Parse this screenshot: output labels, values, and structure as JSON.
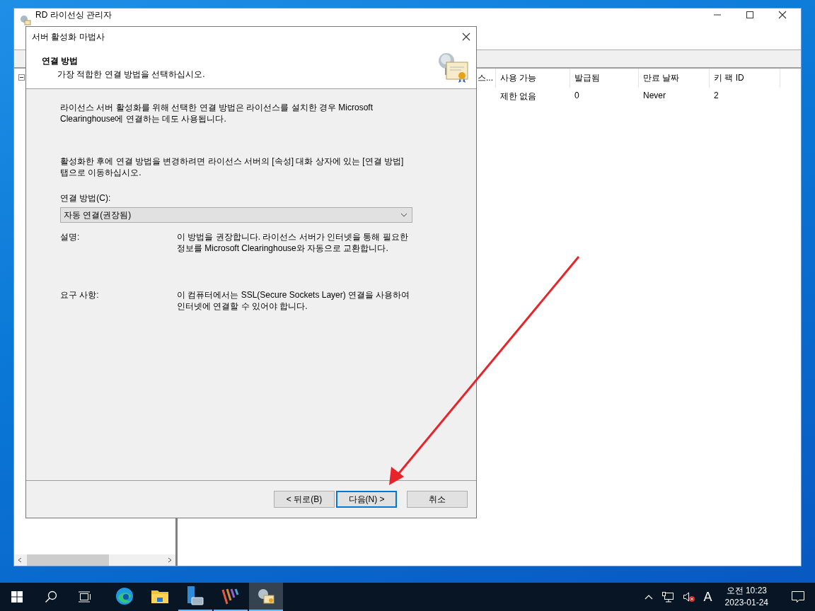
{
  "background_window": {
    "title": "RD 라이선싱 관리자",
    "columns": [
      {
        "label": "스..."
      },
      {
        "label": "사용 가능"
      },
      {
        "label": "발급됨"
      },
      {
        "label": "만료 날짜"
      },
      {
        "label": "키 팩 ID"
      }
    ],
    "rows": [
      {
        "cells": [
          "",
          "제한 없음",
          "0",
          "Never",
          "2"
        ]
      }
    ]
  },
  "dialog": {
    "title": "서버 활성화 마법사",
    "header_title": "연결 방법",
    "header_subtitle": "가장 적합한 연결 방법을 선택하십시오.",
    "paragraphs": [
      "라이선스 서버 활성화를 위해 선택한 연결 방법은 라이선스를 설치한 경우 Microsoft Clearinghouse에 연결하는 데도 사용됩니다.",
      "활성화한 후에 연결 방법을 변경하려면 라이선스 서버의 [속성] 대화 상자에 있는 [연결 방법] 탭으로 이동하십시오."
    ],
    "field_label": "연결 방법(C):",
    "dropdown": {
      "value": "자동 연결(권장됨)"
    },
    "details": [
      {
        "label": "설명:",
        "text": "이 방법을 권장합니다. 라이선스 서버가 인터넷을 통해 필요한 정보를 Microsoft Clearinghouse와 자동으로 교환합니다."
      },
      {
        "label": "요구 사항:",
        "text": "이 컴퓨터에서는 SSL(Secure Sockets Layer) 연결을 사용하여 인터넷에 연결할 수 있어야 합니다."
      }
    ],
    "buttons": [
      {
        "label": "< 뒤로(B)",
        "default": false
      },
      {
        "label": "다음(N) >",
        "default": true
      },
      {
        "label": "취소",
        "default": false
      }
    ]
  },
  "taskbar": {
    "apps": [
      {
        "kind": "edge",
        "running": false,
        "selected": false
      },
      {
        "kind": "folder",
        "running": false,
        "selected": false
      },
      {
        "kind": "server",
        "running": true,
        "selected": false
      },
      {
        "kind": "stripes",
        "running": true,
        "selected": false
      },
      {
        "kind": "license",
        "running": true,
        "selected": true
      }
    ],
    "ime": "A",
    "time": "오전 10:23",
    "date": "2023-01-24"
  }
}
